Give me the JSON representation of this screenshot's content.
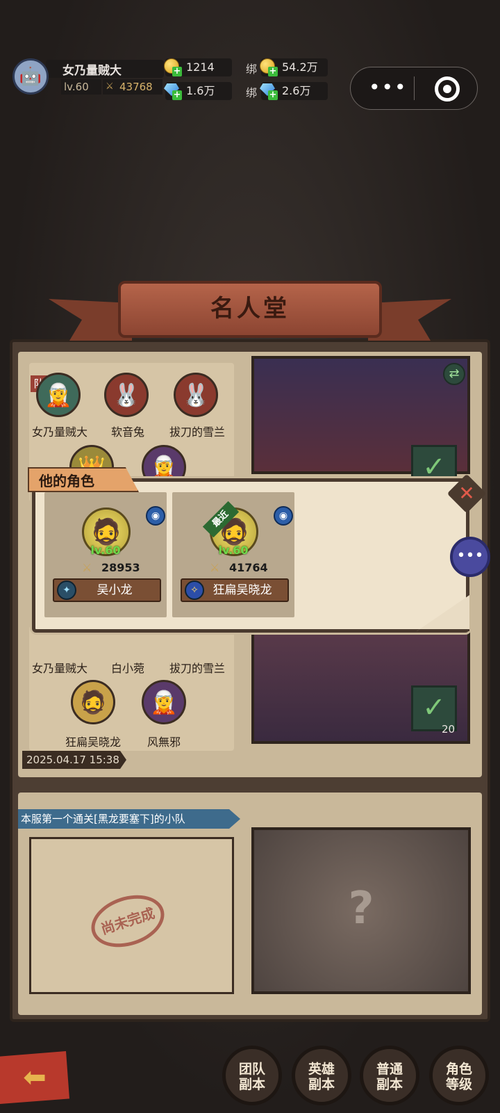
{
  "player": {
    "name": "女乃量贼大",
    "level": "lv.60",
    "power": "43768",
    "gold": "1214",
    "gems": "1.6万",
    "bound_label": "绑",
    "bound_gold": "54.2万",
    "bound_gems": "2.6万"
  },
  "capsule": {
    "more": "•••"
  },
  "hall": {
    "title": "名人堂",
    "team_tag": "队",
    "team1_members": [
      "女乃量贼大",
      "软音兔",
      "拔刀的雪兰"
    ],
    "team2_members": [
      "女乃量贼大",
      "白小菀",
      "拔刀的雪兰",
      "狂扁吴晓龙",
      "风無邪"
    ],
    "date": "2025.04.17 15:38",
    "counter": "20",
    "section2_title": "本服第一个通关[黑龙要塞下]的小队",
    "unfinished_stamp": "尚未完成",
    "mystery": "?"
  },
  "popup": {
    "title": "他的角色",
    "recent_tag": "最近",
    "characters": [
      {
        "level": "lv.60",
        "power": "28953",
        "name": "吴小龙"
      },
      {
        "level": "lv.60",
        "power": "41764",
        "name": "狂扁吴晓龙"
      }
    ]
  },
  "nav": [
    {
      "line1": "团队",
      "line2": "副本"
    },
    {
      "line1": "英雄",
      "line2": "副本"
    },
    {
      "line1": "普通",
      "line2": "副本"
    },
    {
      "line1": "角色",
      "line2": "等级"
    }
  ],
  "colors": {
    "accent": "#b8392c",
    "level_green": "#6fd84a",
    "popup_bg": "#efe3cc"
  }
}
